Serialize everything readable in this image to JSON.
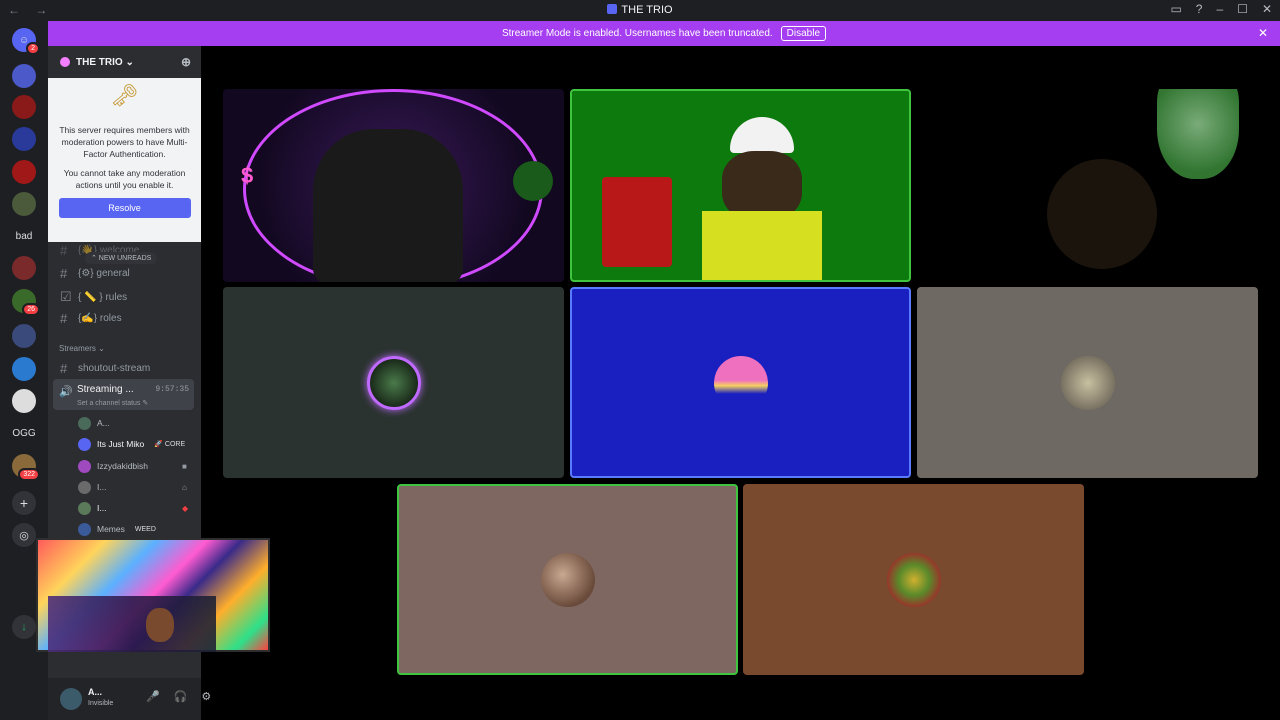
{
  "titlebar": {
    "title": "THE TRIO",
    "nav": "← →"
  },
  "banner": {
    "text": "Streamer Mode is enabled. Usernames have been truncated.",
    "disable_label": "Disable",
    "close": "✕"
  },
  "guilds": [
    {
      "label": "",
      "badge": "2",
      "color": "#5865f2"
    },
    {
      "label": "bad",
      "badge": "",
      "color": ""
    },
    {
      "label": "OGG",
      "badge": "",
      "color": ""
    },
    {
      "label": "",
      "badge": "26",
      "color": "#4a8a3a"
    },
    {
      "label": "",
      "badge": "322",
      "color": "#8a3a3a"
    }
  ],
  "server": {
    "name": "THE TRIO ⌄"
  },
  "mfa": {
    "message": "This server requires members with moderation powers to have Multi-Factor Authentication.",
    "note": "You cannot take any moderation actions until you enable it.",
    "resolve_label": "Resolve"
  },
  "channels": [
    {
      "name": "{👋} welcome",
      "icon": "#"
    },
    {
      "name": "{⚙} general",
      "icon": "#"
    },
    {
      "name": "{ 📏 } rules",
      "icon": "☑"
    },
    {
      "name": "{✍} roles",
      "icon": "#"
    }
  ],
  "unreads_label": "⌃ NEW UNREADS",
  "category": {
    "name": "Streamers ⌄"
  },
  "shoutout": {
    "name": "shoutout-stream"
  },
  "voice_channel": {
    "name": "Streaming ...",
    "timer": "9:57:35",
    "status": "Set a channel status ✎"
  },
  "members": [
    {
      "name": "A...",
      "tag": "",
      "color": "#4a6a5a"
    },
    {
      "name": "Its Just Miko",
      "tag": "🚀 CORE",
      "color": "#5865f2"
    },
    {
      "name": "Izzydakidbish",
      "tag": "",
      "color": "#a04ac0"
    },
    {
      "name": "I...",
      "tag": "",
      "color": "#6a6a6a"
    },
    {
      "name": "I...",
      "tag": "",
      "color": "#5a7a5a"
    },
    {
      "name": "Memes",
      "tag": "WEED",
      "color": "#3a5a9a"
    }
  ],
  "user": {
    "name": "A...",
    "status": "Invisible"
  },
  "tiles": [
    {
      "label": "$",
      "color": "#2a1842"
    },
    {
      "label": "",
      "color": "#0d7a0d"
    },
    {
      "label": "",
      "color": "#000000"
    },
    {
      "label": "",
      "color": "#2a3330"
    },
    {
      "label": "",
      "color": "#1a20c0"
    },
    {
      "label": "",
      "color": "#6e6a63"
    },
    {
      "label": "",
      "color": "#7d6760"
    },
    {
      "label": "",
      "color": "#7a4a2e"
    }
  ]
}
